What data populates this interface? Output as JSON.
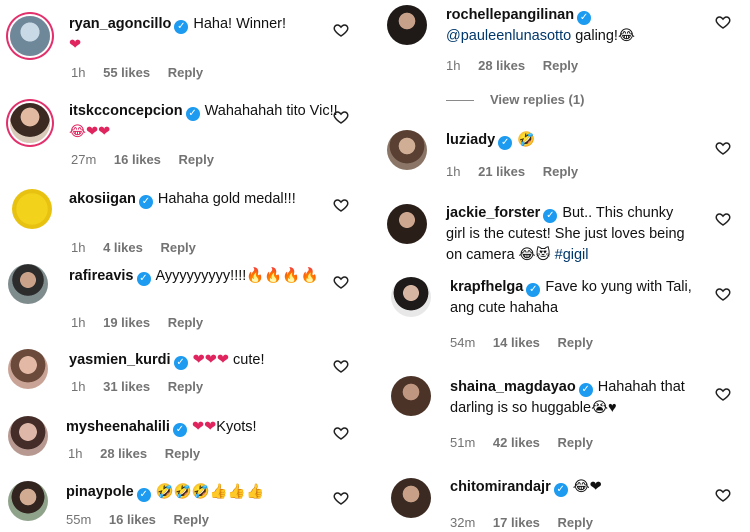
{
  "left_comments": [
    {
      "username": "ryan_agoncillo",
      "text": "Haha! Winner!",
      "emoji": "❤",
      "time": "1h",
      "likes": "55 likes",
      "reply": "Reply"
    },
    {
      "username": "itskcconcepcion",
      "text": "Wahahahah tito Vic!!",
      "emoji": "😂❤❤",
      "time": "27m",
      "likes": "16 likes",
      "reply": "Reply"
    },
    {
      "username": "akosiigan",
      "text": "Hahaha gold medal!!!",
      "emoji": "",
      "time": "1h",
      "likes": "4 likes",
      "reply": "Reply"
    },
    {
      "username": "rafireavis",
      "text": "Ayyyyyyyyy!!!!",
      "emoji": "🔥🔥🔥🔥",
      "time": "1h",
      "likes": "19 likes",
      "reply": "Reply"
    },
    {
      "username": "yasmien_kurdi",
      "text": "cute!",
      "emoji": "❤❤❤",
      "time": "1h",
      "likes": "31 likes",
      "reply": "Reply"
    },
    {
      "username": "mysheenahalili",
      "text": "Kyots!",
      "emoji": "❤❤",
      "time": "1h",
      "likes": "28 likes",
      "reply": "Reply"
    },
    {
      "username": "pinaypole",
      "text": "",
      "emoji": "🤣🤣🤣👍👍👍",
      "time": "55m",
      "likes": "16 likes",
      "reply": "Reply"
    }
  ],
  "right_comments": [
    {
      "username": "rochellepangilinan",
      "mention": "@pauleenlunasotto",
      "text": "galing!",
      "emoji": "😂",
      "time": "1h",
      "likes": "28 likes",
      "reply": "Reply",
      "view_replies": "View replies (1)"
    },
    {
      "username": "luziady",
      "text": "",
      "emoji": "🤣",
      "time": "1h",
      "likes": "21 likes",
      "reply": "Reply"
    },
    {
      "username": "jackie_forster",
      "text": "But.. This chunky girl is the cutest! She just loves being on camera",
      "emoji": "😂😻",
      "hashtag": "#gigil",
      "time": "",
      "likes": "",
      "reply": ""
    },
    {
      "username": "krapfhelga",
      "text": "Fave ko yung with Tali, ang cute hahaha",
      "emoji": "",
      "time": "54m",
      "likes": "14 likes",
      "reply": "Reply"
    },
    {
      "username": "shaina_magdayao",
      "text": "Hahahah that darling is so huggable",
      "emoji": "😭♥",
      "time": "51m",
      "likes": "42 likes",
      "reply": "Reply"
    },
    {
      "username": "chitomirandajr",
      "text": "",
      "emoji": "😂❤",
      "time": "32m",
      "likes": "17 likes",
      "reply": "Reply"
    }
  ],
  "colors": {
    "verified": "#1d9bf0",
    "heart": "#e0245e",
    "meta": "#737373",
    "mention": "#00376b"
  },
  "icons": {
    "like": "heart-outline-icon",
    "verified": "verified-badge-icon"
  }
}
